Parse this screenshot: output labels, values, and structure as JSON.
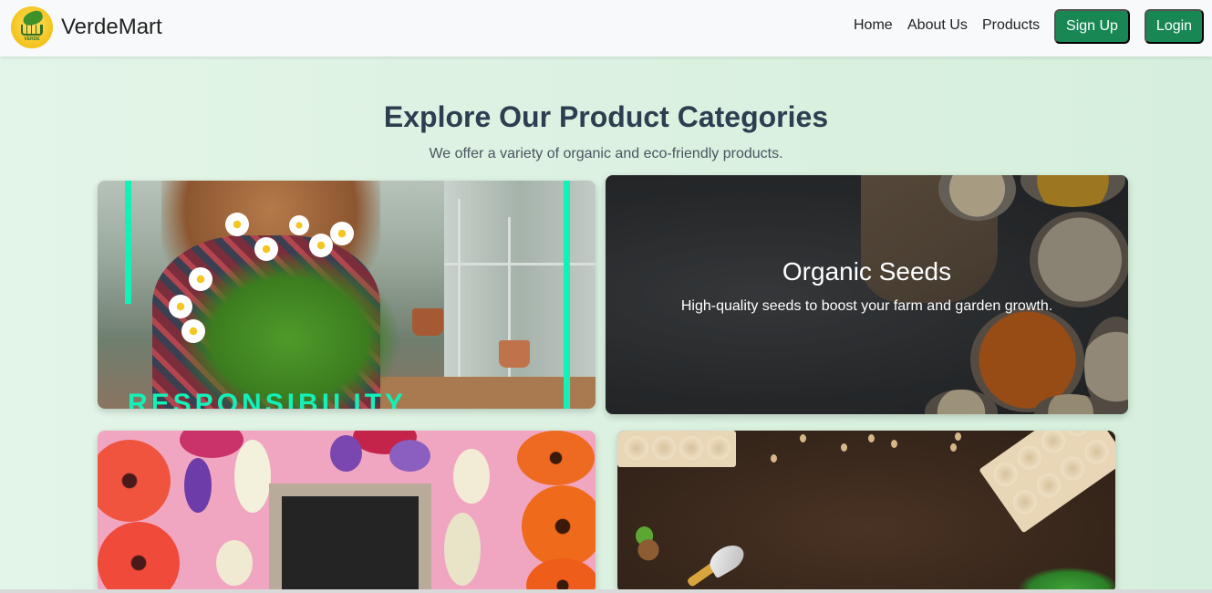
{
  "brand": {
    "name": "VerdeMart",
    "logo_text": "VERDE",
    "logo_icon": "parrot-cart-logo"
  },
  "nav": {
    "links": [
      "Home",
      "About Us",
      "Products"
    ],
    "signup_label": "Sign Up",
    "login_label": "Login"
  },
  "section": {
    "title": "Explore Our Product Categories",
    "subtitle": "We offer a variety of organic and eco-friendly products."
  },
  "cards": [
    {
      "image": "woman-holding-flowers-in-greenhouse",
      "overlay_text": "RESPONSIBILITY"
    },
    {
      "image": "seeds-in-bowls",
      "title": "Organic Seeds",
      "description": "High-quality seeds to boost your farm and garden growth."
    },
    {
      "image": "flowers-around-chalkboard"
    },
    {
      "image": "soil-with-trowel-and-seedling-trays"
    }
  ],
  "colors": {
    "primary_button": "#198754",
    "heading": "#2c3e50",
    "accent_bar": "#13f0b8"
  }
}
